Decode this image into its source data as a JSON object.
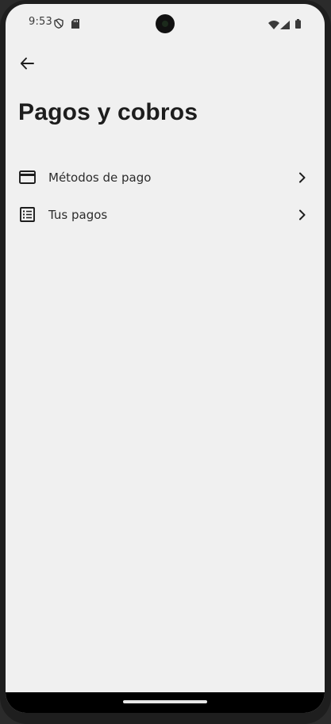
{
  "status_bar": {
    "time": "9:53",
    "icons": [
      "shield-icon",
      "sd-card-icon",
      "wifi-icon",
      "signal-icon",
      "battery-icon"
    ]
  },
  "header": {
    "back_icon": "arrow-back-icon",
    "title": "Pagos y cobros"
  },
  "menu": {
    "items": [
      {
        "icon": "credit-card-icon",
        "label": "Métodos de pago",
        "trailing_icon": "chevron-right-icon"
      },
      {
        "icon": "list-icon",
        "label": "Tus pagos",
        "trailing_icon": "chevron-right-icon"
      }
    ]
  },
  "colors": {
    "background": "#f0f0f0",
    "text_primary": "#1d1d1d",
    "nav_bar": "#000000"
  }
}
